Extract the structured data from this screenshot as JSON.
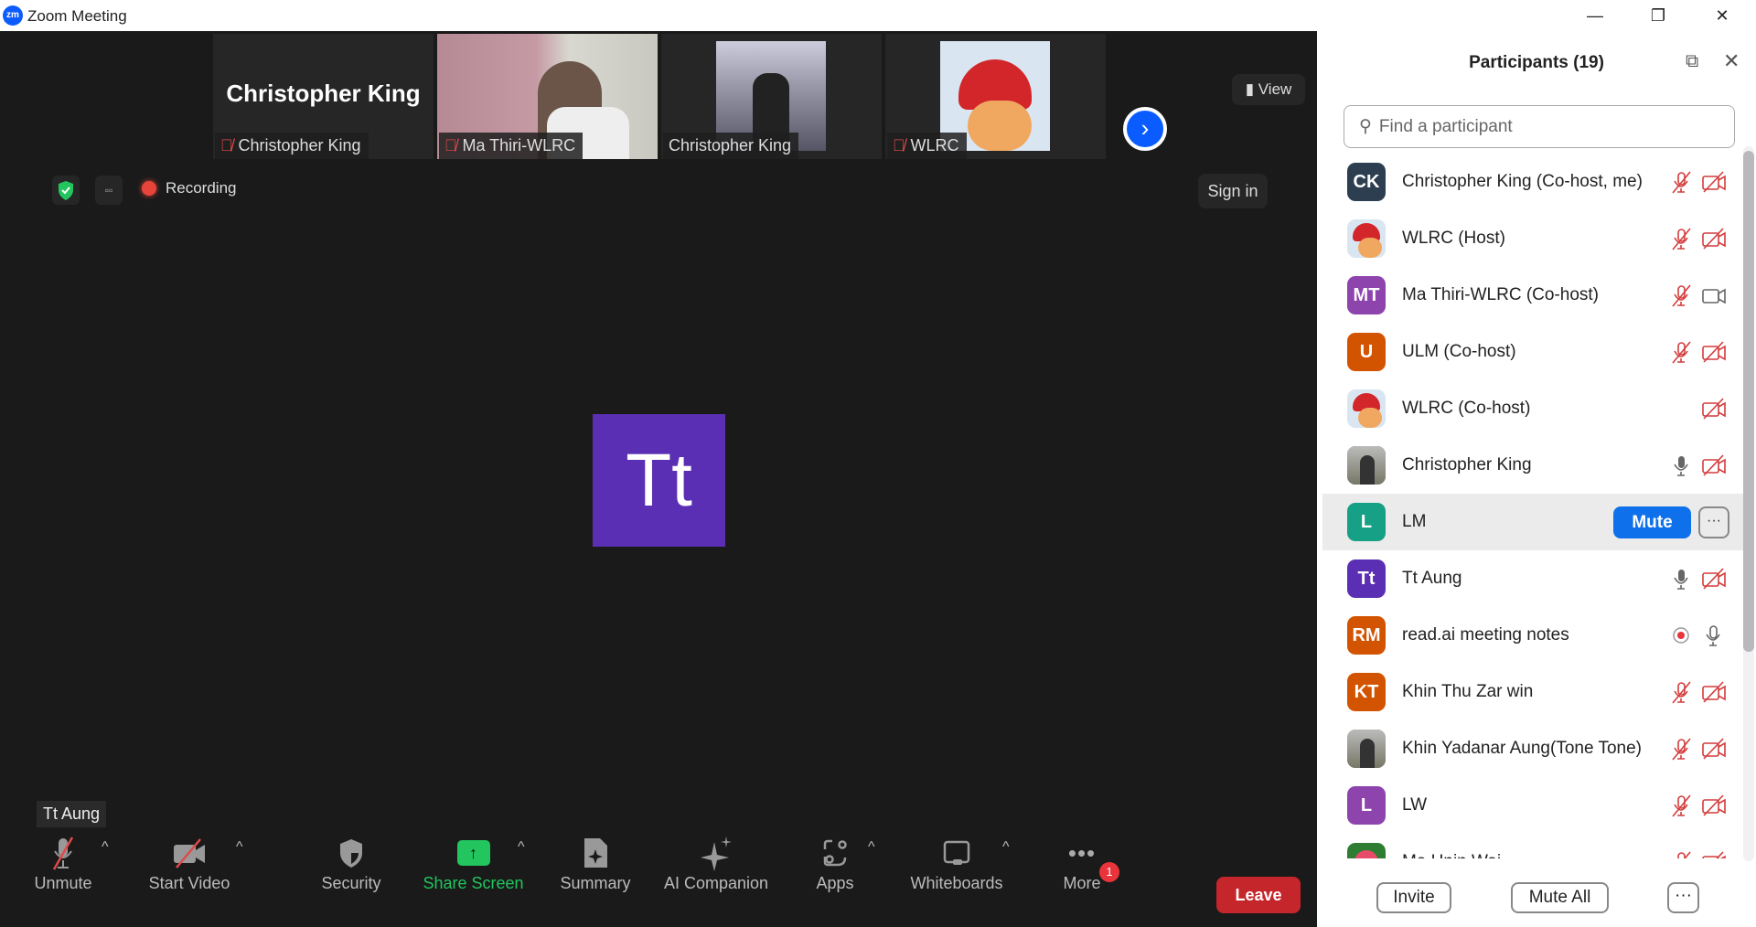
{
  "window": {
    "title": "Zoom Meeting",
    "logo": "zm",
    "minimize": "—",
    "restore": "❐",
    "close": "✕"
  },
  "strip": {
    "tiles": [
      {
        "big_name": "Christopher King",
        "label": "Christopher King",
        "muted": true
      },
      {
        "label": "Ma Thiri-WLRC",
        "muted": true
      },
      {
        "label": "Christopher King",
        "muted": false
      },
      {
        "label": "WLRC",
        "muted": true
      }
    ],
    "next_icon": "›",
    "view_label": "View"
  },
  "status": {
    "recording_label": "Recording",
    "sign_in": "Sign in"
  },
  "active_speaker": {
    "initials": "Tt",
    "tooltip": "Tt Aung"
  },
  "toolbar": {
    "unmute": "Unmute",
    "start_video": "Start Video",
    "security": "Security",
    "share_screen": "Share Screen",
    "summary": "Summary",
    "ai_companion": "AI Companion",
    "apps": "Apps",
    "whiteboards": "Whiteboards",
    "more": "More",
    "more_badge": "1",
    "leave": "Leave",
    "caret": "^"
  },
  "participants": {
    "title": "Participants (19)",
    "search_placeholder": "Find a participant",
    "rows": [
      {
        "name": "Christopher King (Co-host, me)",
        "initials": "CK",
        "color": "#2c3e50",
        "mic": "muted",
        "video": "off"
      },
      {
        "name": "WLRC (Host)",
        "initials": "",
        "color": "#d9e6f2",
        "mic": "muted",
        "video": "off",
        "image": "cartoon"
      },
      {
        "name": "Ma Thiri-WLRC (Co-host)",
        "initials": "MT",
        "color": "#8e44ad",
        "mic": "muted",
        "video": "on"
      },
      {
        "name": "ULM (Co-host)",
        "initials": "U",
        "color": "#d35400",
        "mic": "muted",
        "video": "off"
      },
      {
        "name": "WLRC (Co-host)",
        "initials": "",
        "color": "#d9e6f2",
        "mic": "none",
        "video": "off",
        "image": "cartoon"
      },
      {
        "name": "Christopher King",
        "initials": "",
        "color": "#556",
        "mic": "on",
        "video": "off",
        "image": "photo"
      },
      {
        "name": "LM",
        "initials": "L",
        "color": "#16a085",
        "hover": true,
        "mute_label": "Mute",
        "more_label": "···"
      },
      {
        "name": "Tt Aung",
        "initials": "Tt",
        "color": "#5b2fb3",
        "mic": "on",
        "video": "off"
      },
      {
        "name": "read.ai meeting notes",
        "initials": "RM",
        "color": "#d35400",
        "mic": "record",
        "video": "mic"
      },
      {
        "name": "Khin Thu Zar win",
        "initials": "KT",
        "color": "#d35400",
        "mic": "muted",
        "video": "off"
      },
      {
        "name": "Khin Yadanar Aung(Tone Tone)",
        "initials": "",
        "color": "#8a8a7a",
        "mic": "muted",
        "video": "off",
        "image": "photo"
      },
      {
        "name": "LW",
        "initials": "L",
        "color": "#8e44ad",
        "mic": "muted",
        "video": "off"
      },
      {
        "name": "Ma Hnin Wai",
        "initials": "",
        "color": "#2e7d32",
        "mic": "muted",
        "video": "off",
        "image": "flower"
      }
    ],
    "invite": "Invite",
    "mute_all": "Mute All",
    "more": "···"
  },
  "colors": {
    "accent": "#0b5cff",
    "muted_red": "#d43c3c",
    "share_green": "#22c55e",
    "leave_red": "#c4262b",
    "mute_blue": "#0e71eb"
  }
}
